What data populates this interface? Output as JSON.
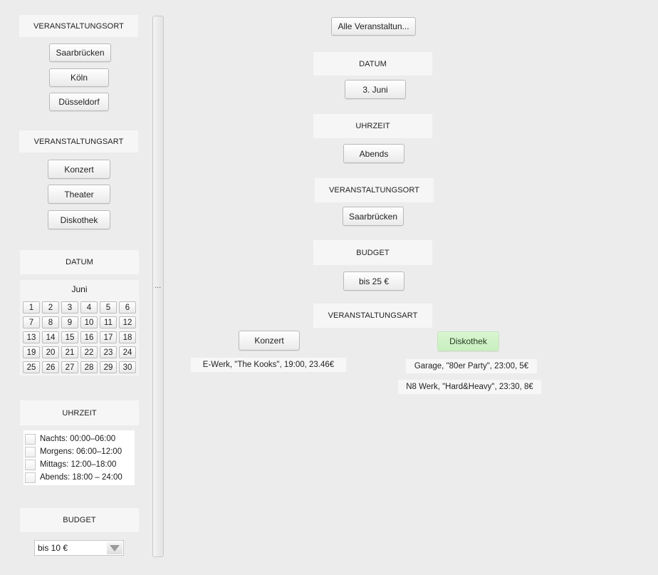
{
  "sidebar": {
    "ort": {
      "header": "VERANSTALTUNGSORT",
      "options": [
        "Saarbrücken",
        "Köln",
        "Düsseldorf"
      ]
    },
    "art": {
      "header": "VERANSTALTUNGSART",
      "options": [
        "Konzert",
        "Theater",
        "Diskothek"
      ]
    },
    "datum": {
      "header": "DATUM",
      "month": "Juni",
      "days": [
        "1",
        "2",
        "3",
        "4",
        "5",
        "6",
        "7",
        "8",
        "9",
        "10",
        "11",
        "12",
        "13",
        "14",
        "15",
        "16",
        "17",
        "18",
        "19",
        "20",
        "21",
        "22",
        "23",
        "24",
        "25",
        "26",
        "27",
        "28",
        "29",
        "30"
      ]
    },
    "uhrzeit": {
      "header": "UHRZEIT",
      "options": [
        "Nachts: 00:00–06:00",
        "Morgens: 06:00–12:00",
        "Mittags: 12:00–18:00",
        "Abends: 18:00 – 24:00"
      ]
    },
    "budget": {
      "header": "BUDGET",
      "selected": "bis 10 €"
    }
  },
  "splitter": {
    "handle": "..."
  },
  "main": {
    "all_button": "Alle Veranstaltun...",
    "datum": {
      "header": "DATUM",
      "value": "3. Juni"
    },
    "uhrzeit": {
      "header": "UHRZEIT",
      "value": "Abends"
    },
    "ort": {
      "header": "VERANSTALTUNGSORT",
      "value": "Saarbrücken"
    },
    "budget": {
      "header": "BUDGET",
      "value": "bis 25 €"
    },
    "art": {
      "header": "VERANSTALTUNGSART"
    },
    "categories": [
      {
        "label": "Konzert",
        "results": [
          "E-Werk, \"The Kooks\", 19:00, 23.46€"
        ]
      },
      {
        "label": "Diskothek",
        "results": [
          "Garage, \"80er Party\", 23:00, 5€",
          "N8 Werk, \"Hard&Heavy\", 23:30, 8€"
        ]
      }
    ]
  },
  "colors": {
    "background": "#ececec",
    "highlight": "#d2f2c9"
  }
}
